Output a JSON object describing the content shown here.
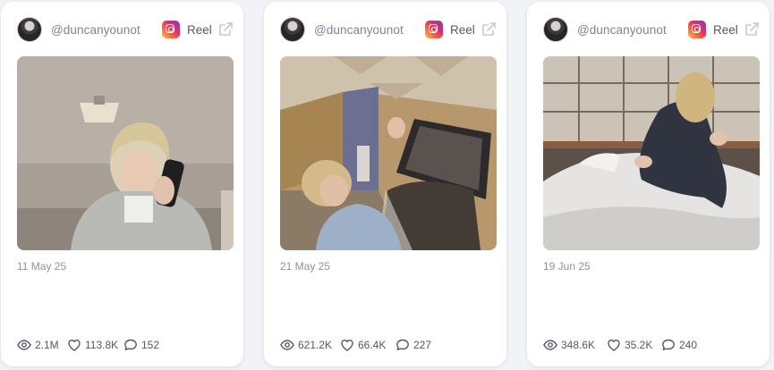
{
  "cards": [
    {
      "username": "@duncanyounot",
      "platform_icon": "instagram-icon",
      "type": "Reel",
      "date": "11 May 25",
      "views": "2.1M",
      "likes": "113.8K",
      "comments": "152"
    },
    {
      "username": "@duncanyounot",
      "platform_icon": "instagram-icon",
      "type": "Reel",
      "date": "21 May 25",
      "views": "621.2K",
      "likes": "66.4K",
      "comments": "227"
    },
    {
      "username": "@duncanyounot",
      "platform_icon": "instagram-icon",
      "type": "Reel",
      "date": "19 Jun 25",
      "views": "348.6K",
      "likes": "35.2K",
      "comments": "240"
    }
  ],
  "colors": {
    "page_background": "#f1f3f6",
    "card_background": "#ffffff",
    "muted_text": "#7b8596",
    "stat_text": "#515a68"
  }
}
